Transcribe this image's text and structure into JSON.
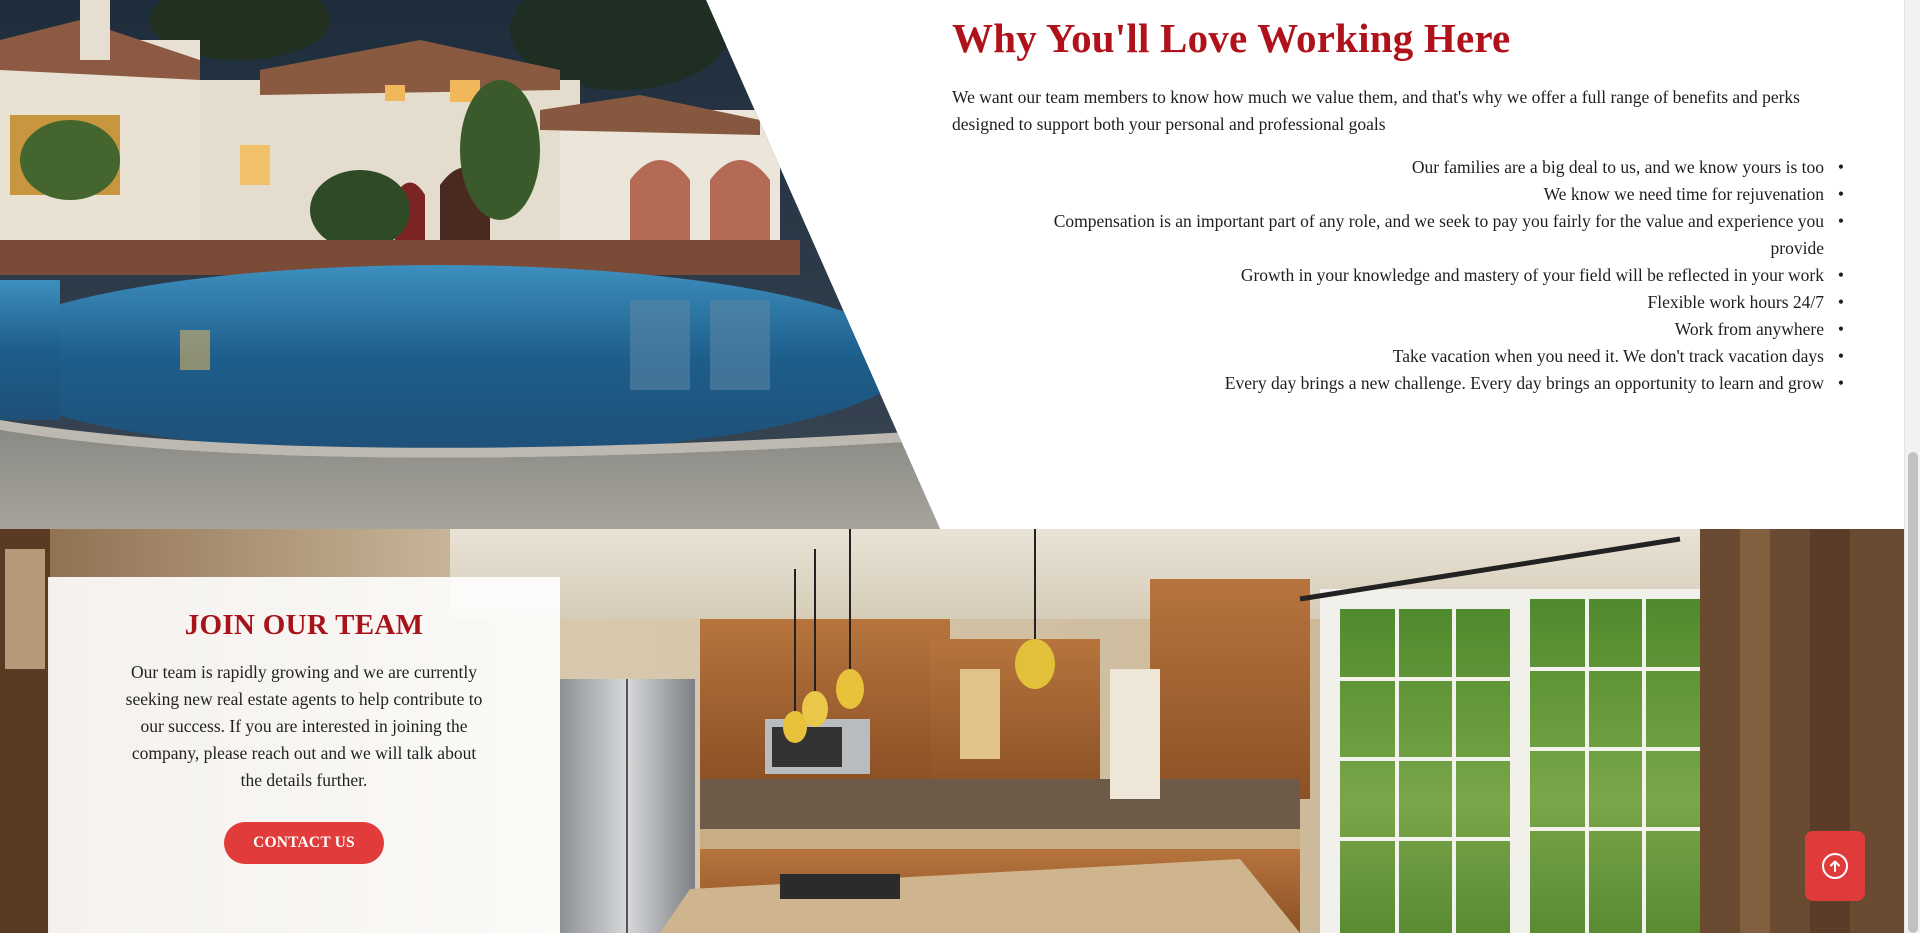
{
  "benefits": {
    "title": "Why You'll Love Working Here",
    "intro": "We want our team members to know how much we value them, and that's why we offer a full range of benefits and perks designed to support both your personal and professional goals",
    "perks": [
      "Our families are a big deal to us, and we know yours is too",
      "We know we need time for rejuvenation",
      "Compensation is an important part of any role, and we seek to pay you fairly for the value and experience you provide",
      "Growth in your knowledge and mastery of your field will be reflected in your work",
      "Flexible work hours 24/7",
      "Work from anywhere",
      "Take vacation when you need it. We don't track vacation days",
      "Every day brings a new challenge. Every day brings an opportunity to learn and grow"
    ],
    "bullet": "•",
    "photo": "pool-villa-photo"
  },
  "join": {
    "title": "JOIN OUR TEAM",
    "text": "Our team is rapidly growing and we are currently seeking new real estate agents to help contribute to our success. If you are interested in joining the company, please reach out and we will talk about the details further.",
    "button_label": "CONTACT US",
    "photo": "kitchen-photo"
  },
  "back_to_top": {
    "icon": "arrow-up-circle-icon"
  },
  "colors": {
    "accent_red": "#b0121b",
    "button_red": "#e23b3b"
  }
}
